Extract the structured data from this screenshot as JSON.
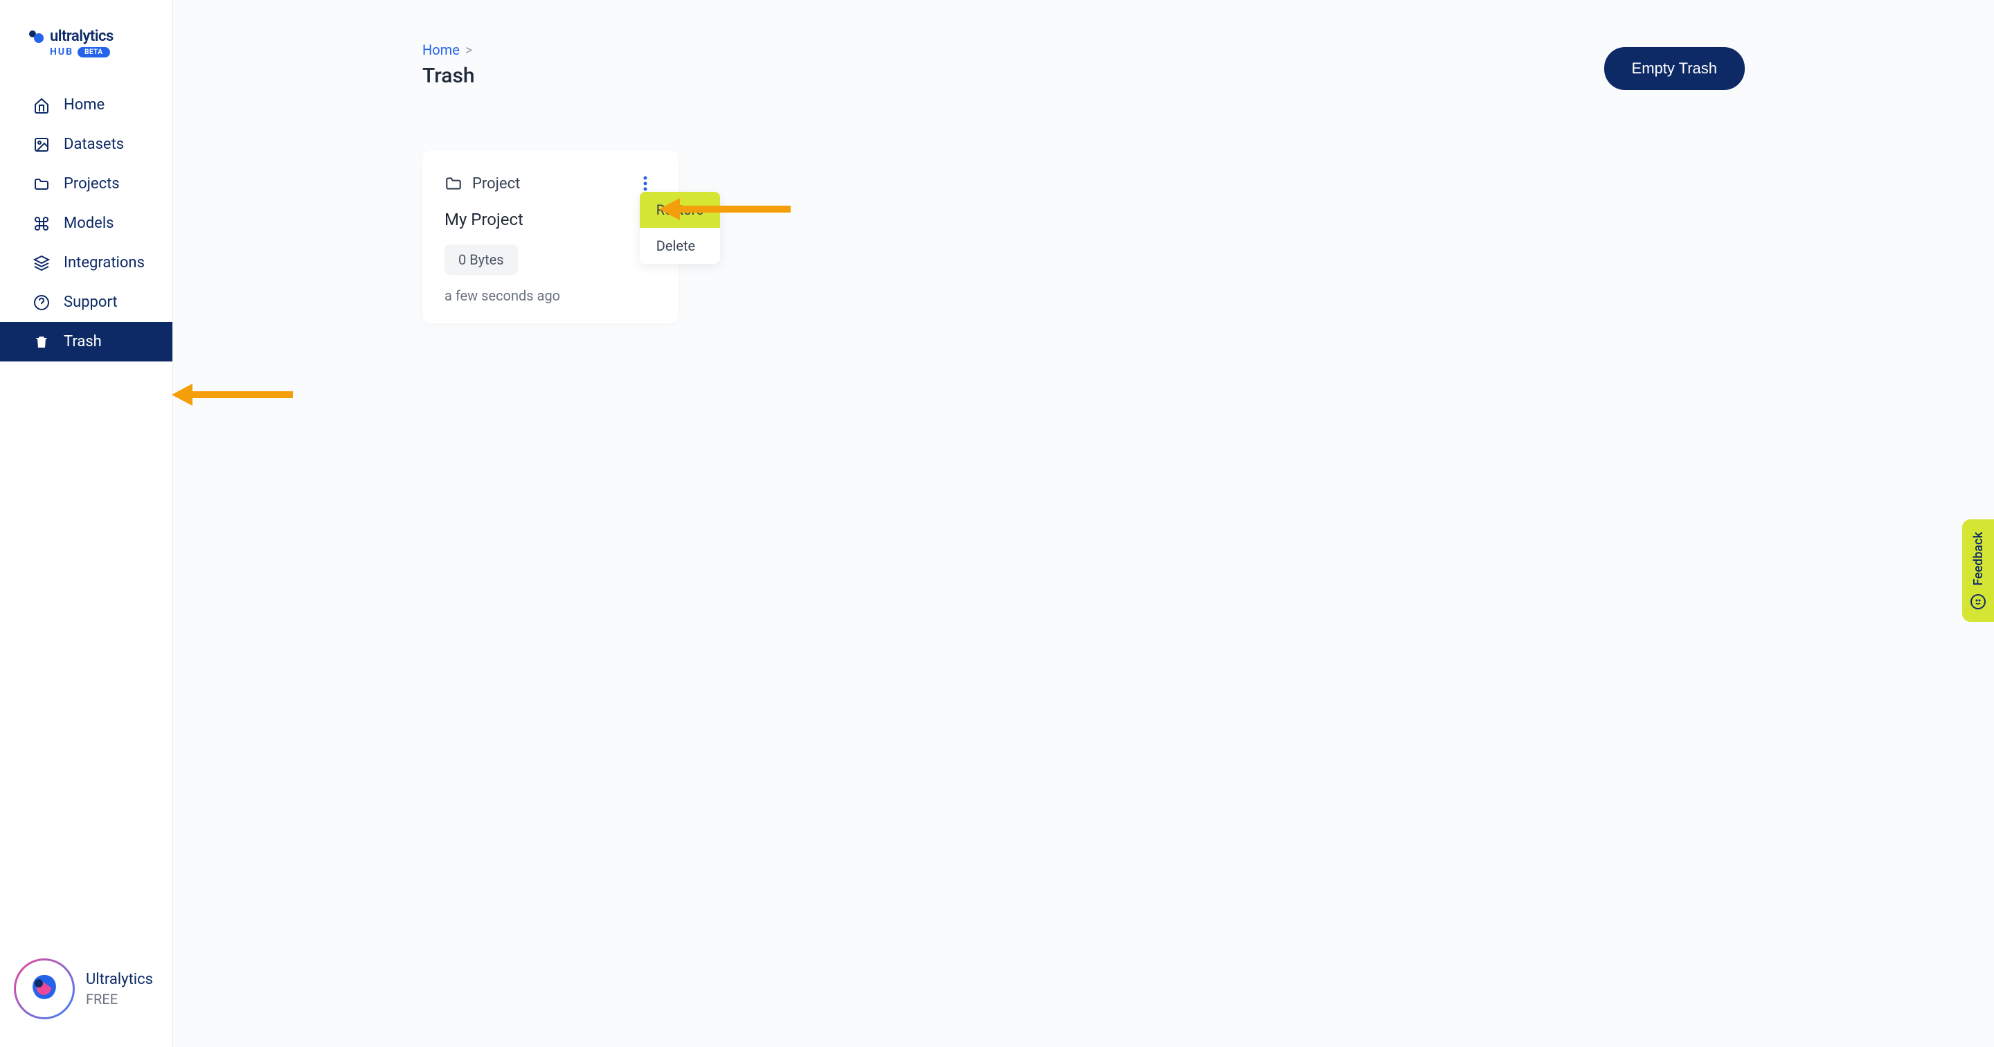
{
  "logo": {
    "brand": "ultralytics",
    "hub": "HUB",
    "beta": "BETA"
  },
  "sidebar": {
    "items": [
      {
        "label": "Home",
        "icon": "home"
      },
      {
        "label": "Datasets",
        "icon": "image"
      },
      {
        "label": "Projects",
        "icon": "folder"
      },
      {
        "label": "Models",
        "icon": "command"
      },
      {
        "label": "Integrations",
        "icon": "layers"
      },
      {
        "label": "Support",
        "icon": "help"
      },
      {
        "label": "Trash",
        "icon": "trash",
        "active": true
      }
    ]
  },
  "footer": {
    "name": "Ultralytics",
    "plan": "FREE"
  },
  "breadcrumb": {
    "home": "Home",
    "sep": ">"
  },
  "page": {
    "title": "Trash",
    "empty_btn": "Empty Trash"
  },
  "card": {
    "type": "Project",
    "title": "My Project",
    "size": "0 Bytes",
    "time": "a few seconds ago"
  },
  "dropdown": {
    "restore": "Restore",
    "delete": "Delete"
  },
  "feedback": {
    "label": "Feedback"
  }
}
